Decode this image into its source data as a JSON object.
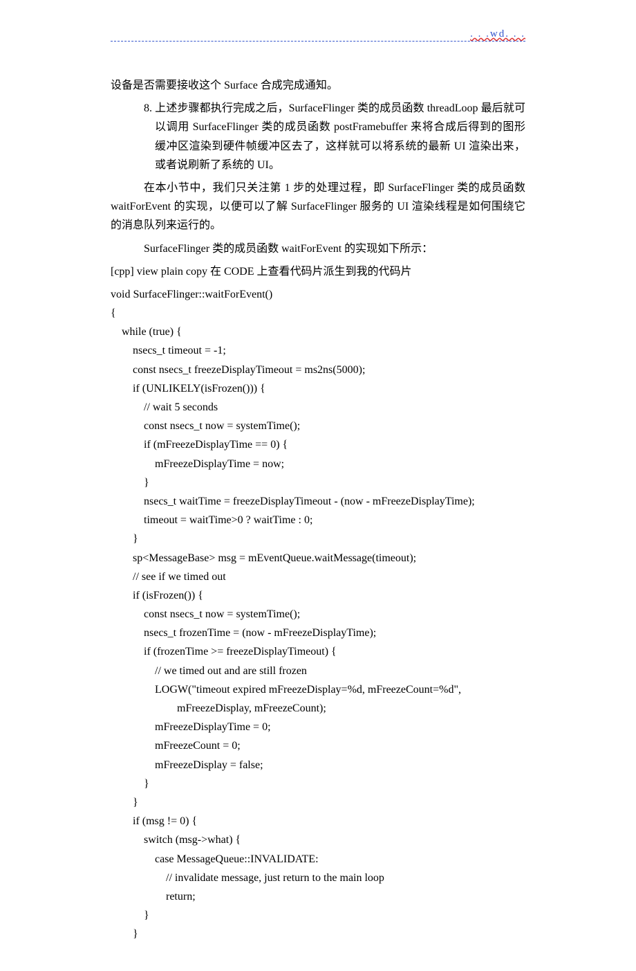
{
  "header": {
    "watermark": ". . .wd. . ."
  },
  "paragraphs": {
    "p1": "设备是否需要接收这个 Surface 合成完成通知。",
    "p2": "8.  上述步骤都执行完成之后，SurfaceFlinger 类的成员函数 threadLoop 最后就可以调用 SurfaceFlinger 类的成员函数 postFramebuffer 来将合成后得到的图形缓冲区渲染到硬件帧缓冲区去了，这样就可以将系统的最新 UI 渲染出来，或者说刷新了系统的 UI。",
    "p3": "在本小节中，我们只关注第 1 步的处理过程，即 SurfaceFlinger 类的成员函数 waitForEvent 的实现，以便可以了解 SurfaceFlinger 服务的 UI 渲染线程是如何围绕它的消息队列来运行的。",
    "p4": "SurfaceFlinger 类的成员函数 waitForEvent 的实现如下所示：",
    "p5": "[cpp] view plain copy  在 CODE 上查看代码片派生到我的代码片"
  },
  "code": {
    "l01": "void SurfaceFlinger::waitForEvent()  ",
    "l02": "{  ",
    "l03": "    while (true) {  ",
    "l04": "        nsecs_t timeout = -1;  ",
    "l05": "        const nsecs_t freezeDisplayTimeout = ms2ns(5000);  ",
    "l06": "        if (UNLIKELY(isFrozen())) {  ",
    "l07": "            // wait 5 seconds  ",
    "l08": "            const nsecs_t now = systemTime();  ",
    "l09": "            if (mFreezeDisplayTime == 0) {  ",
    "l10": "                mFreezeDisplayTime = now;  ",
    "l11": "            }  ",
    "l12": "            nsecs_t waitTime = freezeDisplayTimeout - (now - mFreezeDisplayTime);  ",
    "l13": "            timeout = waitTime>0 ? waitTime : 0;  ",
    "l14": "        }  ",
    "l15": "        sp<MessageBase> msg = mEventQueue.waitMessage(timeout);  ",
    "l16": "        // see if we timed out  ",
    "l17": "        if (isFrozen()) {  ",
    "l18": "            const nsecs_t now = systemTime();  ",
    "l19": "            nsecs_t frozenTime = (now - mFreezeDisplayTime);  ",
    "l20": "            if (frozenTime >= freezeDisplayTimeout) {  ",
    "l21": "                // we timed out and are still frozen  ",
    "l22": "                LOGW(\"timeout expired mFreezeDisplay=%d, mFreezeCount=%d\",  ",
    "l23": "                        mFreezeDisplay, mFreezeCount);  ",
    "l24": "                mFreezeDisplayTime = 0;  ",
    "l25": "                mFreezeCount = 0;  ",
    "l26": "                mFreezeDisplay = false;  ",
    "l27": "            }  ",
    "l28": "        }  ",
    "l29": "        if (msg != 0) {  ",
    "l30": "            switch (msg->what) {  ",
    "l31": "                case MessageQueue::INVALIDATE:  ",
    "l32": "                    // invalidate message, just return to the main loop  ",
    "l33": "                    return;  ",
    "l34": "            }  ",
    "l35": "        }  "
  }
}
